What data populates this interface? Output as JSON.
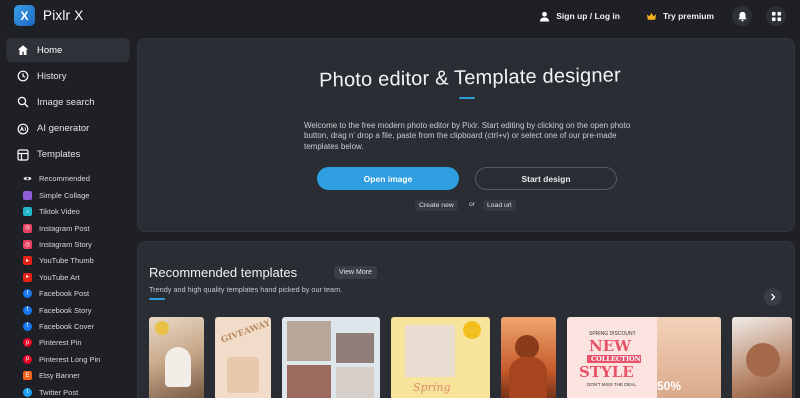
{
  "app": {
    "name": "Pixlr X",
    "logo_letter": "X"
  },
  "topbar": {
    "signup_label": "Sign up / Log in",
    "premium_label": "Try premium",
    "icons": [
      "user-icon",
      "crown-icon",
      "bell-icon",
      "apps-grid-icon"
    ]
  },
  "sidebar": {
    "main": [
      {
        "label": "Home",
        "icon": "home-icon",
        "active": true
      },
      {
        "label": "History",
        "icon": "clock-icon"
      },
      {
        "label": "Image search",
        "icon": "search-icon"
      },
      {
        "label": "AI generator",
        "icon": "ai-icon"
      },
      {
        "label": "Templates",
        "icon": "templates-icon"
      }
    ],
    "templates": [
      {
        "label": "Recommended",
        "icon": "eye-icon",
        "color": "#2a2d33"
      },
      {
        "label": "Simple Collage",
        "icon": "collage-icon",
        "color": "#8e5bd9"
      },
      {
        "label": "Tiktok Video",
        "icon": "tiktok-icon",
        "color": "#1fb6c9"
      },
      {
        "label": "Instagram Post",
        "icon": "instagram-icon",
        "color": "#e4405f"
      },
      {
        "label": "Instagram Story",
        "icon": "instagram-icon",
        "color": "#e4405f"
      },
      {
        "label": "YouTube Thumb",
        "icon": "youtube-icon",
        "color": "#e62117"
      },
      {
        "label": "YouTube Art",
        "icon": "youtube-icon",
        "color": "#e62117"
      },
      {
        "label": "Facebook Post",
        "icon": "facebook-icon",
        "color": "#1877f2"
      },
      {
        "label": "Facebook Story",
        "icon": "facebook-icon",
        "color": "#1877f2"
      },
      {
        "label": "Facebook Cover",
        "icon": "facebook-icon",
        "color": "#1877f2"
      },
      {
        "label": "Pinterest Pin",
        "icon": "pinterest-icon",
        "color": "#e60023"
      },
      {
        "label": "Pinterest Long Pin",
        "icon": "pinterest-icon",
        "color": "#e60023"
      },
      {
        "label": "Etsy Banner",
        "icon": "etsy-icon",
        "color": "#f1641e"
      },
      {
        "label": "Twitter Post",
        "icon": "twitter-icon",
        "color": "#1da1f2"
      }
    ]
  },
  "hero": {
    "title": "Photo editor & Template designer",
    "description": "Welcome to the free modern photo editor by Pixlr. Start editing by clicking on the open photo button, drag n' drop a file, paste from the clipboard (ctrl+v) or select one of our pre-made templates below.",
    "open_image_label": "Open image",
    "start_design_label": "Start design",
    "create_new_label": "Create new",
    "or_label": "or",
    "load_url_label": "Load url"
  },
  "templates": {
    "title": "Recommended templates",
    "view_more_label": "View More",
    "subtitle": "Trendy and high quality templates hand picked by our team.",
    "cards": [
      {
        "name": "template-card-1",
        "texts": []
      },
      {
        "name": "template-card-2",
        "texts": [
          "GIVEAWAY"
        ]
      },
      {
        "name": "template-card-3",
        "texts": []
      },
      {
        "name": "template-card-4",
        "texts": [
          "Spring"
        ]
      },
      {
        "name": "template-card-5",
        "texts": []
      },
      {
        "name": "template-card-6",
        "texts": [
          "SPRING DISCOUNT",
          "NEW",
          "COLLECTION",
          "STYLE",
          "DON'T MISS THE DEAL",
          "50%"
        ]
      },
      {
        "name": "template-card-7",
        "texts": []
      }
    ]
  },
  "colors": {
    "accent": "#2e9ee0",
    "background": "#1e2025",
    "panel": "#2a2d33"
  }
}
